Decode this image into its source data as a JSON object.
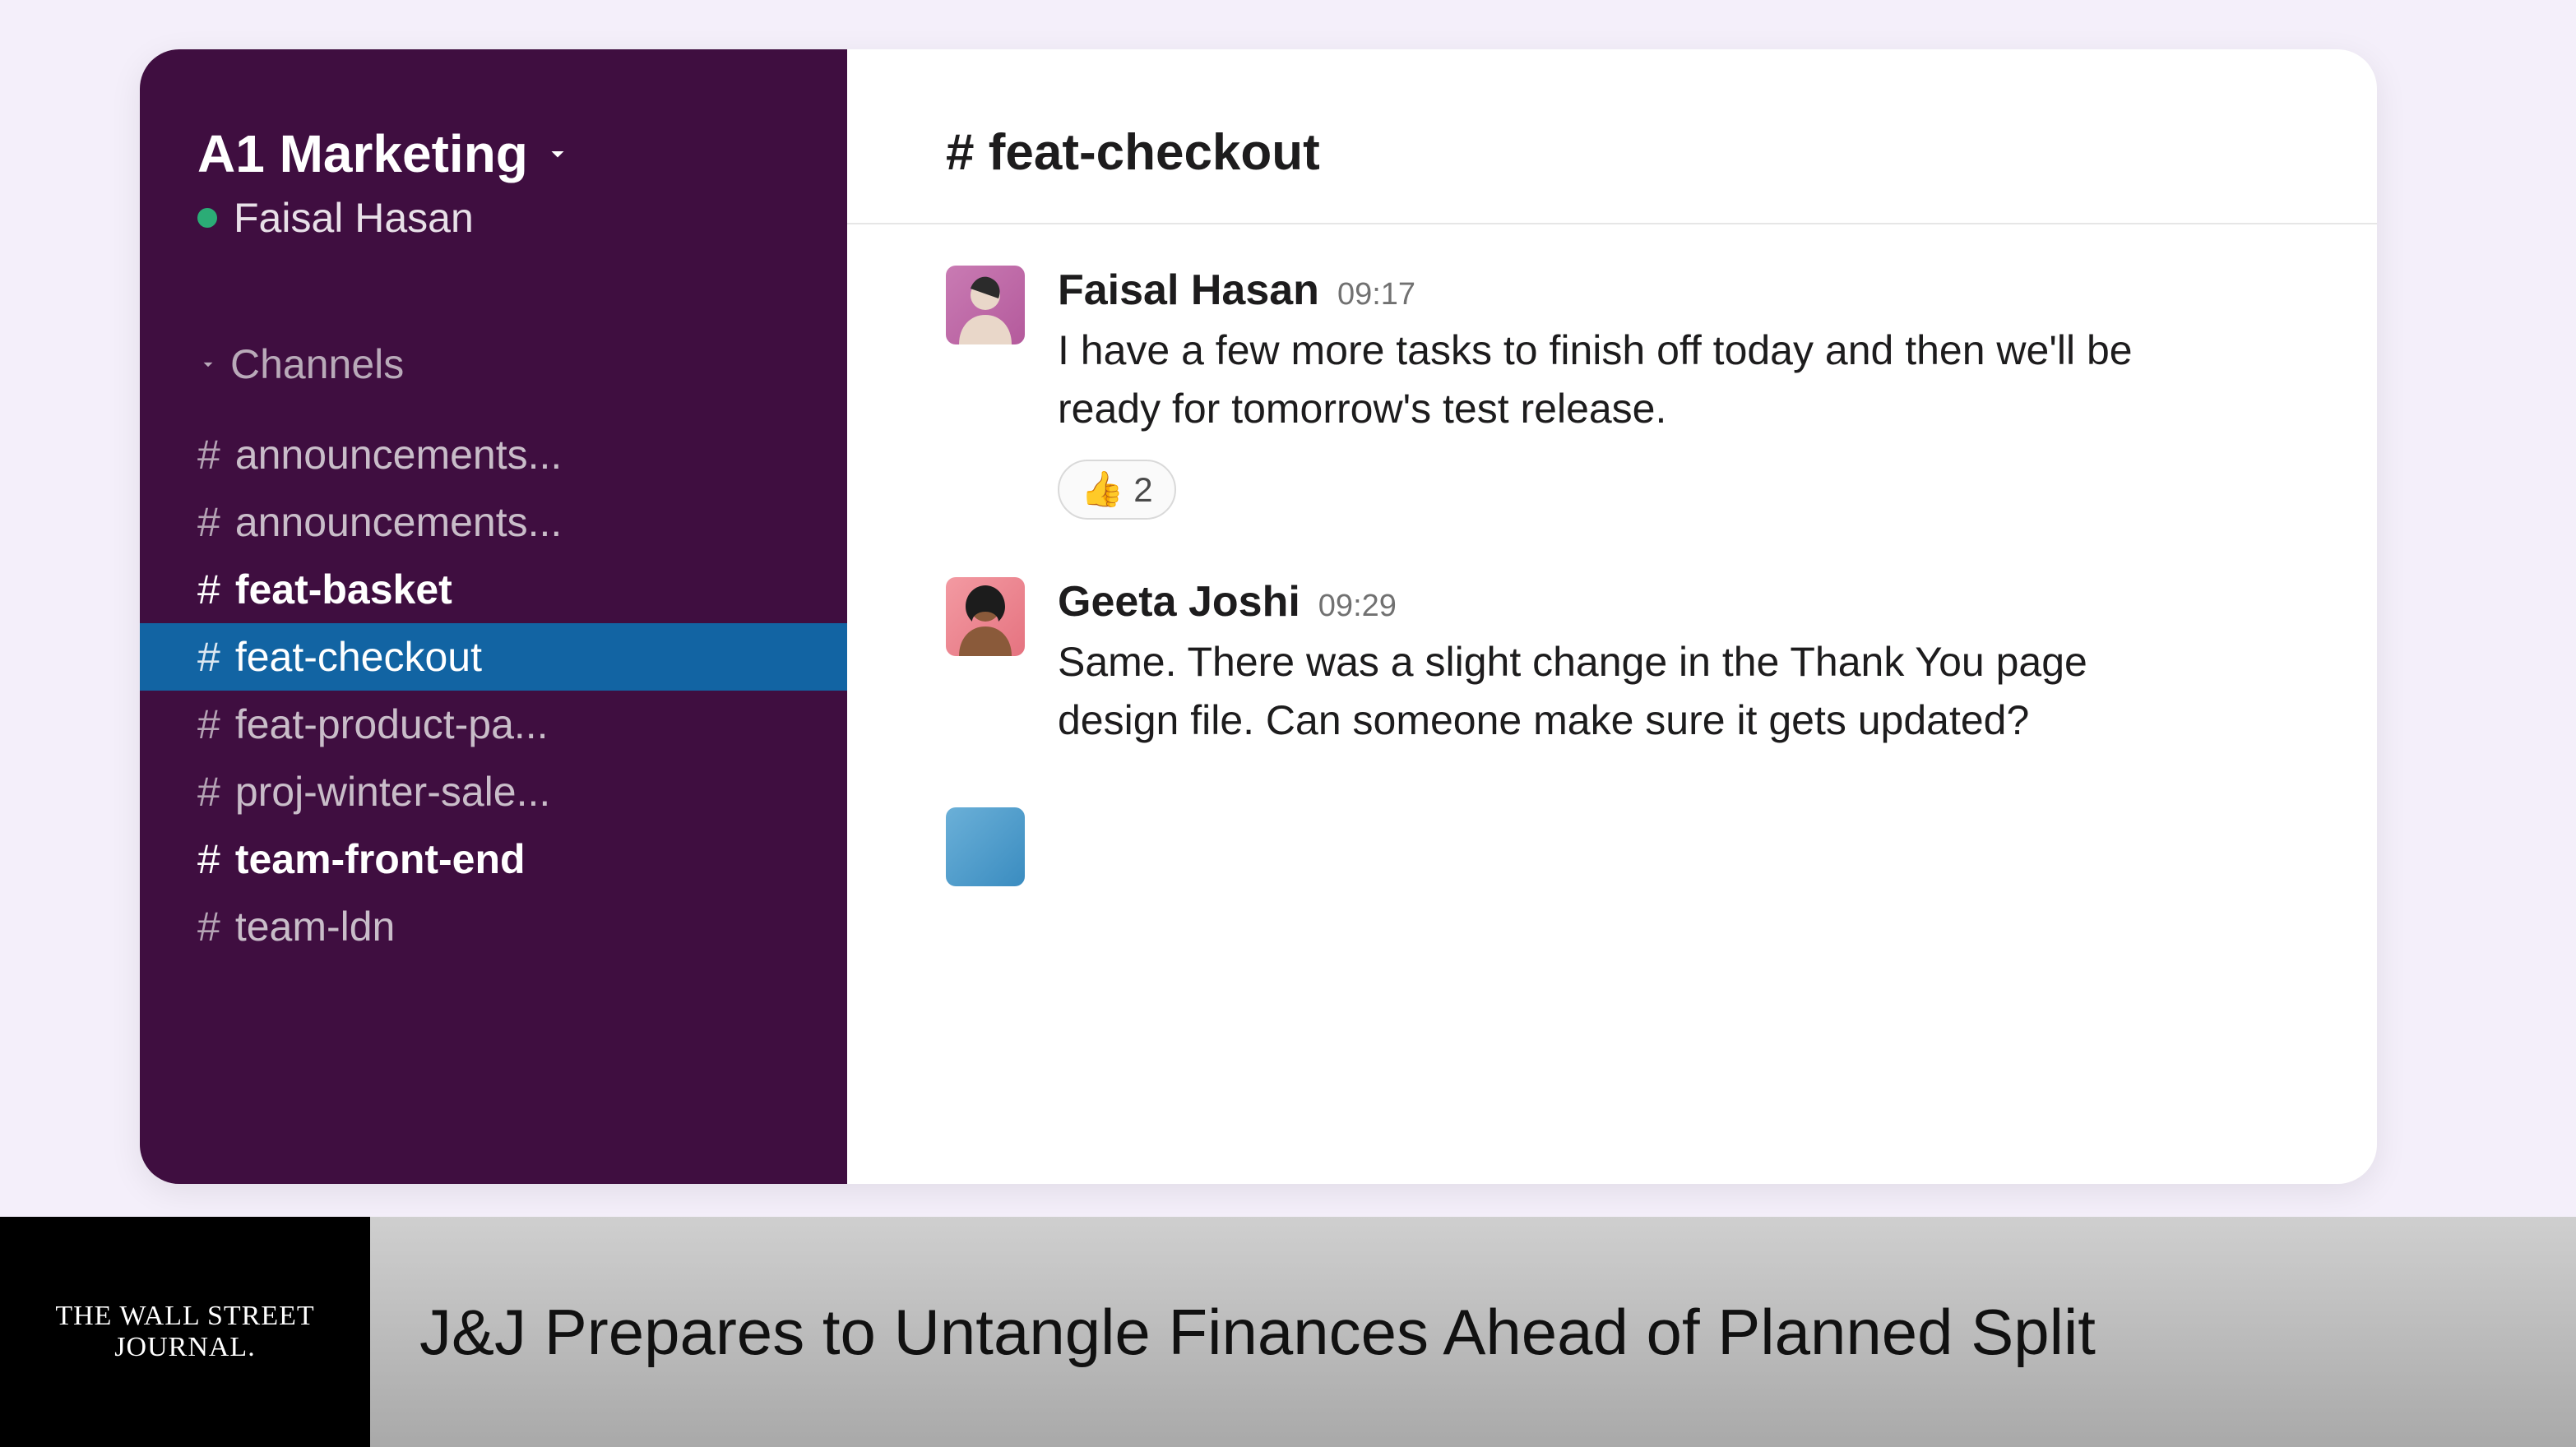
{
  "workspace": {
    "name": "A1 Marketing",
    "user": "Faisal Hasan"
  },
  "sidebar": {
    "section_label": "Channels",
    "channels": [
      {
        "name": "announcements...",
        "unread": false,
        "active": false
      },
      {
        "name": "announcements...",
        "unread": false,
        "active": false
      },
      {
        "name": "feat-basket",
        "unread": true,
        "active": false
      },
      {
        "name": "feat-checkout",
        "unread": false,
        "active": true
      },
      {
        "name": "feat-product-pa...",
        "unread": false,
        "active": false
      },
      {
        "name": "proj-winter-sale...",
        "unread": false,
        "active": false
      },
      {
        "name": "team-front-end",
        "unread": true,
        "active": false
      },
      {
        "name": "team-ldn",
        "unread": false,
        "active": false
      }
    ]
  },
  "channel_header": {
    "title": "# feat-checkout"
  },
  "messages": [
    {
      "author": "Faisal Hasan",
      "time": "09:17",
      "text": "I have a few more tasks to finish off today and then we'll be ready for tomorrow's test release.",
      "reaction": {
        "emoji": "👍",
        "count": "2"
      }
    },
    {
      "author": "Geeta Joshi",
      "time": "09:29",
      "text": "Same. There was a slight change in the Thank You page design file. Can someone make sure it gets updated?"
    }
  ],
  "ticker": {
    "source": "THE WALL STREET JOURNAL.",
    "headline": "J&J Prepares to Untangle Finances Ahead of Planned Split"
  }
}
